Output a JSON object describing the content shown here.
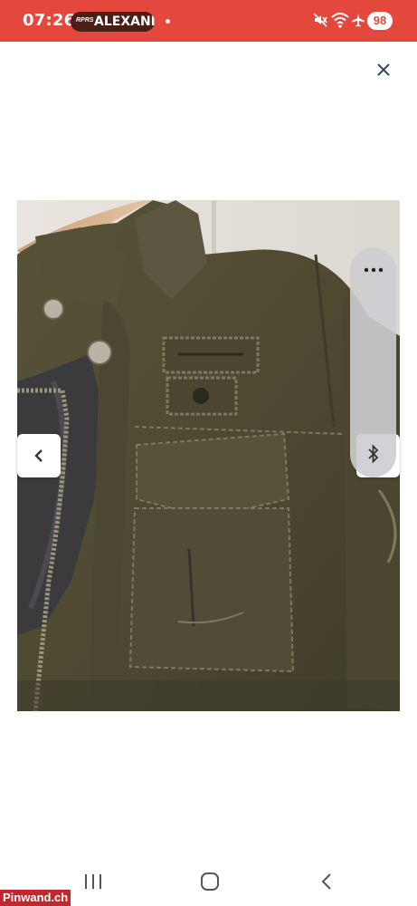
{
  "status_bar": {
    "time": "07:26",
    "media_label": "ALEXANI",
    "media_mini_label": "RPRS",
    "battery": "98",
    "accent_color": "#e4473b",
    "icons": [
      "mute-icon",
      "wifi-icon",
      "airplane-icon"
    ]
  },
  "viewer": {
    "close_icon": "close-icon",
    "prev_icon": "chevron-left-icon",
    "panel_icons": [
      "more-icon",
      "bluetooth-icon"
    ]
  },
  "nav_bar": {
    "icons": [
      "recent-apps-icon",
      "home-icon",
      "back-icon"
    ]
  },
  "watermark": {
    "text": "Pinwand.ch",
    "color": "#c1272d"
  }
}
